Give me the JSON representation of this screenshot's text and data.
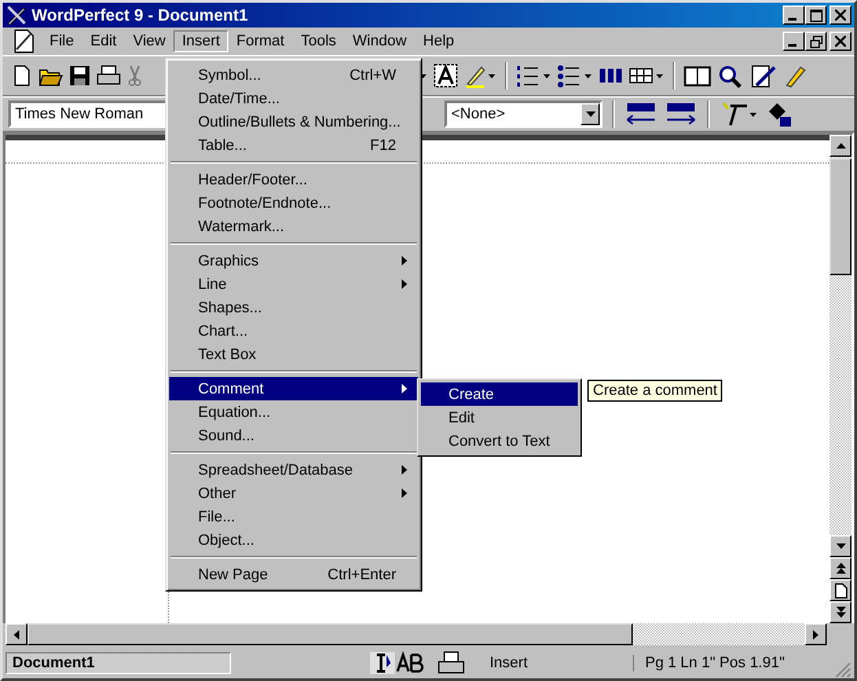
{
  "window": {
    "title": "WordPerfect 9 - Document1"
  },
  "menu_bar": [
    {
      "label": "File",
      "selected": false
    },
    {
      "label": "Edit",
      "selected": false
    },
    {
      "label": "View",
      "selected": false
    },
    {
      "label": "Insert",
      "selected": true
    },
    {
      "label": "Format",
      "selected": false
    },
    {
      "label": "Tools",
      "selected": false
    },
    {
      "label": "Window",
      "selected": false
    },
    {
      "label": "Help",
      "selected": false
    }
  ],
  "property_bar": {
    "font": "Times New Roman",
    "style": "<None>"
  },
  "insert_menu": [
    [
      {
        "label": "Symbol...",
        "shortcut": "Ctrl+W",
        "submenu": false,
        "selected": false
      },
      {
        "label": "Date/Time...",
        "submenu": false,
        "selected": false
      },
      {
        "label": "Outline/Bullets & Numbering...",
        "submenu": false,
        "selected": false
      },
      {
        "label": "Table...",
        "shortcut": "F12",
        "submenu": false,
        "selected": false
      }
    ],
    [
      {
        "label": "Header/Footer...",
        "submenu": false,
        "selected": false
      },
      {
        "label": "Footnote/Endnote...",
        "submenu": false,
        "selected": false
      },
      {
        "label": "Watermark...",
        "submenu": false,
        "selected": false
      }
    ],
    [
      {
        "label": "Graphics",
        "submenu": true,
        "selected": false
      },
      {
        "label": "Line",
        "submenu": true,
        "selected": false
      },
      {
        "label": "Shapes...",
        "submenu": false,
        "selected": false
      },
      {
        "label": "Chart...",
        "submenu": false,
        "selected": false
      },
      {
        "label": "Text Box",
        "submenu": false,
        "selected": false
      }
    ],
    [
      {
        "label": "Comment",
        "submenu": true,
        "selected": true
      },
      {
        "label": "Equation...",
        "submenu": false,
        "selected": false
      },
      {
        "label": "Sound...",
        "submenu": false,
        "selected": false
      }
    ],
    [
      {
        "label": "Spreadsheet/Database",
        "submenu": true,
        "selected": false
      },
      {
        "label": "Other",
        "submenu": true,
        "selected": false
      },
      {
        "label": "File...",
        "submenu": false,
        "selected": false
      },
      {
        "label": "Object...",
        "submenu": false,
        "selected": false
      }
    ],
    [
      {
        "label": "New Page",
        "shortcut": "Ctrl+Enter",
        "submenu": false,
        "selected": false
      }
    ]
  ],
  "comment_submenu": [
    {
      "label": "Create",
      "selected": true
    },
    {
      "label": "Edit",
      "selected": false
    },
    {
      "label": "Convert to Text",
      "selected": false
    }
  ],
  "tooltip": "Create a comment",
  "status_bar": {
    "document": "Document1",
    "mode": "Insert",
    "position": "Pg 1 Ln 1\" Pos 1.91\""
  }
}
